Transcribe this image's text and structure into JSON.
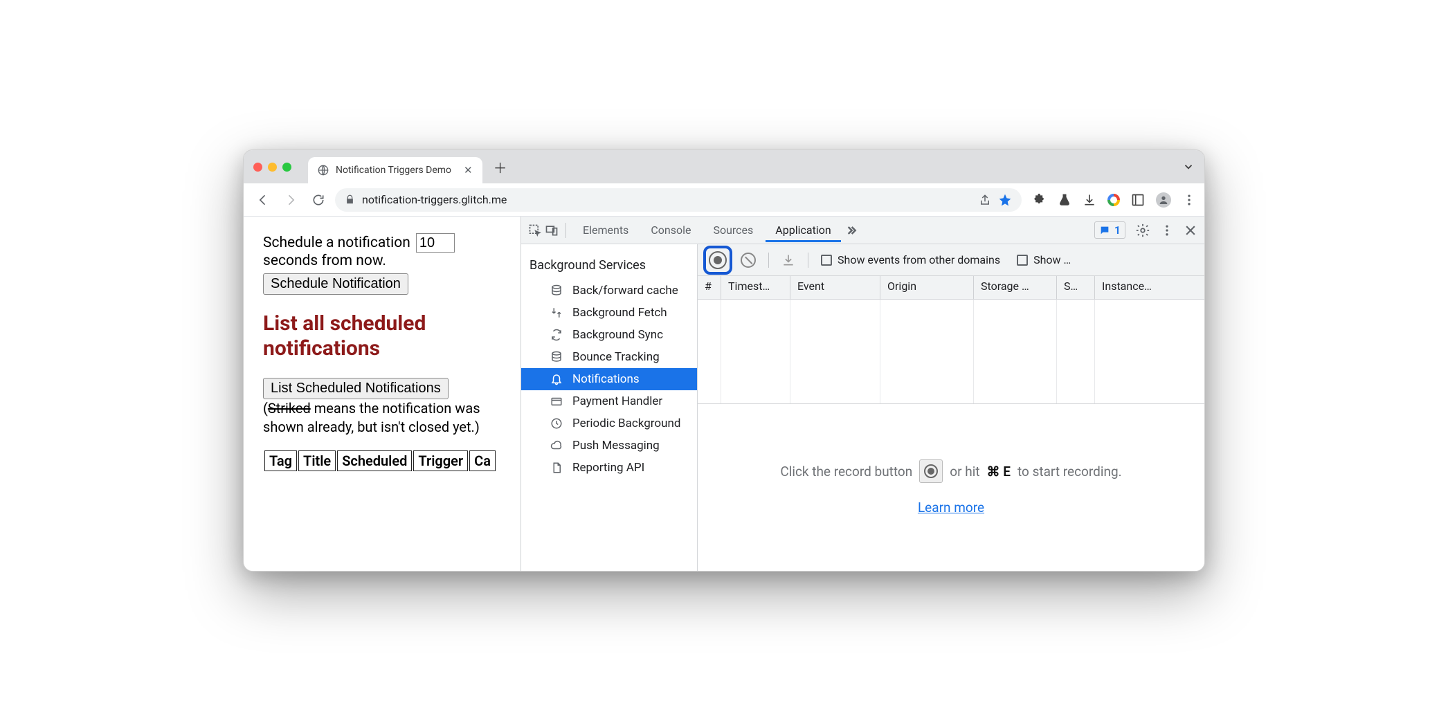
{
  "browser": {
    "tab_title": "Notification Triggers Demo",
    "url": "notification-triggers.glitch.me"
  },
  "page": {
    "schedule_prefix": "Schedule a notification",
    "schedule_value": "10",
    "schedule_suffix": "seconds from now.",
    "schedule_button": "Schedule Notification",
    "heading": "List all scheduled notifications",
    "list_button": "List Scheduled Notifications",
    "note_open": "(",
    "note_striked": "Striked",
    "note_rest": " means the notification was shown already, but isn't closed yet.)",
    "cols": [
      "Tag",
      "Title",
      "Scheduled",
      "Trigger",
      "Ca"
    ]
  },
  "devtools": {
    "tabs": {
      "elements": "Elements",
      "console": "Console",
      "sources": "Sources",
      "application": "Application"
    },
    "issue_count": "1",
    "sidebar_header": "Background Services",
    "sidebar_items": [
      "Back/forward cache",
      "Background Fetch",
      "Background Sync",
      "Bounce Tracking",
      "Notifications",
      "Payment Handler",
      "Periodic Background",
      "Push Messaging",
      "Reporting API"
    ],
    "toolbar": {
      "events_other": "Show events from other domains",
      "show_more": "Show …"
    },
    "columns": [
      "#",
      "Timest…",
      "Event",
      "Origin",
      "Storage …",
      "S…",
      "Instance…"
    ],
    "empty": {
      "text_a": "Click the record button",
      "text_b": "or hit",
      "shortcut": "⌘ E",
      "text_c": "to start recording.",
      "learn_more": "Learn more"
    }
  }
}
